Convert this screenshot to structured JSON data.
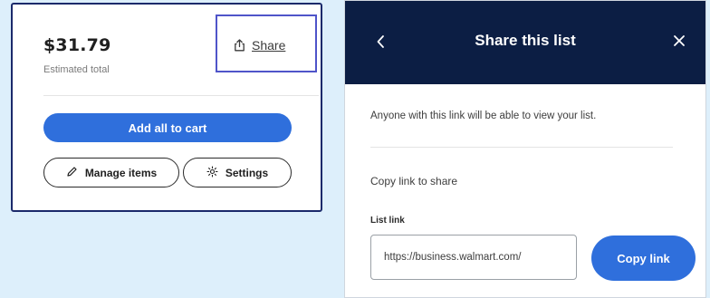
{
  "cart_summary": {
    "total_price": "$31.79",
    "total_label": "Estimated total",
    "share_label": "Share",
    "add_all_label": "Add all to cart",
    "manage_label": "Manage items",
    "settings_label": "Settings",
    "icons": [
      "share-icon",
      "pencil-icon",
      "gear-icon"
    ],
    "highlight_color": "#4f54c9",
    "accent_color": "#2f6fdc"
  },
  "share_modal": {
    "title": "Share this list",
    "description": "Anyone with this link will be able to view your list.",
    "copy_heading": "Copy link to share",
    "field_label": "List link",
    "link_value": "https://business.walmart.com/",
    "copy_button_label": "Copy link",
    "icons": [
      "back-chevron-icon",
      "close-icon"
    ],
    "header_color": "#0c1e44",
    "accent_color": "#2f6fdc"
  }
}
